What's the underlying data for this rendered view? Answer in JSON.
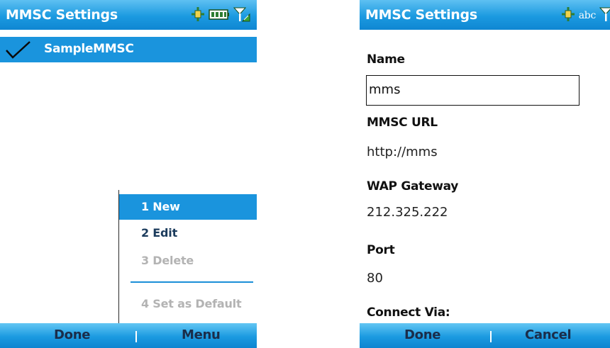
{
  "left": {
    "title": "MMSC Settings",
    "list_item": "SampleMMSC",
    "menu": [
      "1 New",
      "2 Edit",
      "3 Delete",
      "4 Set as Default"
    ],
    "softkeys": {
      "left": "Done",
      "right": "Menu"
    },
    "icons": [
      "connectivity-icon",
      "battery-icon",
      "signal-icon",
      "checkmark-icon"
    ]
  },
  "right": {
    "title": "MMSC Settings",
    "input_mode": "abc",
    "name_label": "Name",
    "name_value": "mms",
    "url_label": "MMSC URL",
    "url_value": "http://mms",
    "gateway_label": "WAP Gateway",
    "gateway_value": "212.325.222",
    "port_label": "Port",
    "port_value": "80",
    "connect_label": "Connect Via:",
    "softkeys": {
      "left": "Done",
      "right": "Cancel"
    },
    "icons": [
      "connectivity-icon",
      "signal-icon"
    ]
  },
  "colors": {
    "accent": "#1a94dd",
    "softkey_text": "#1a2d4a",
    "disabled_text": "#b3b3b3"
  }
}
